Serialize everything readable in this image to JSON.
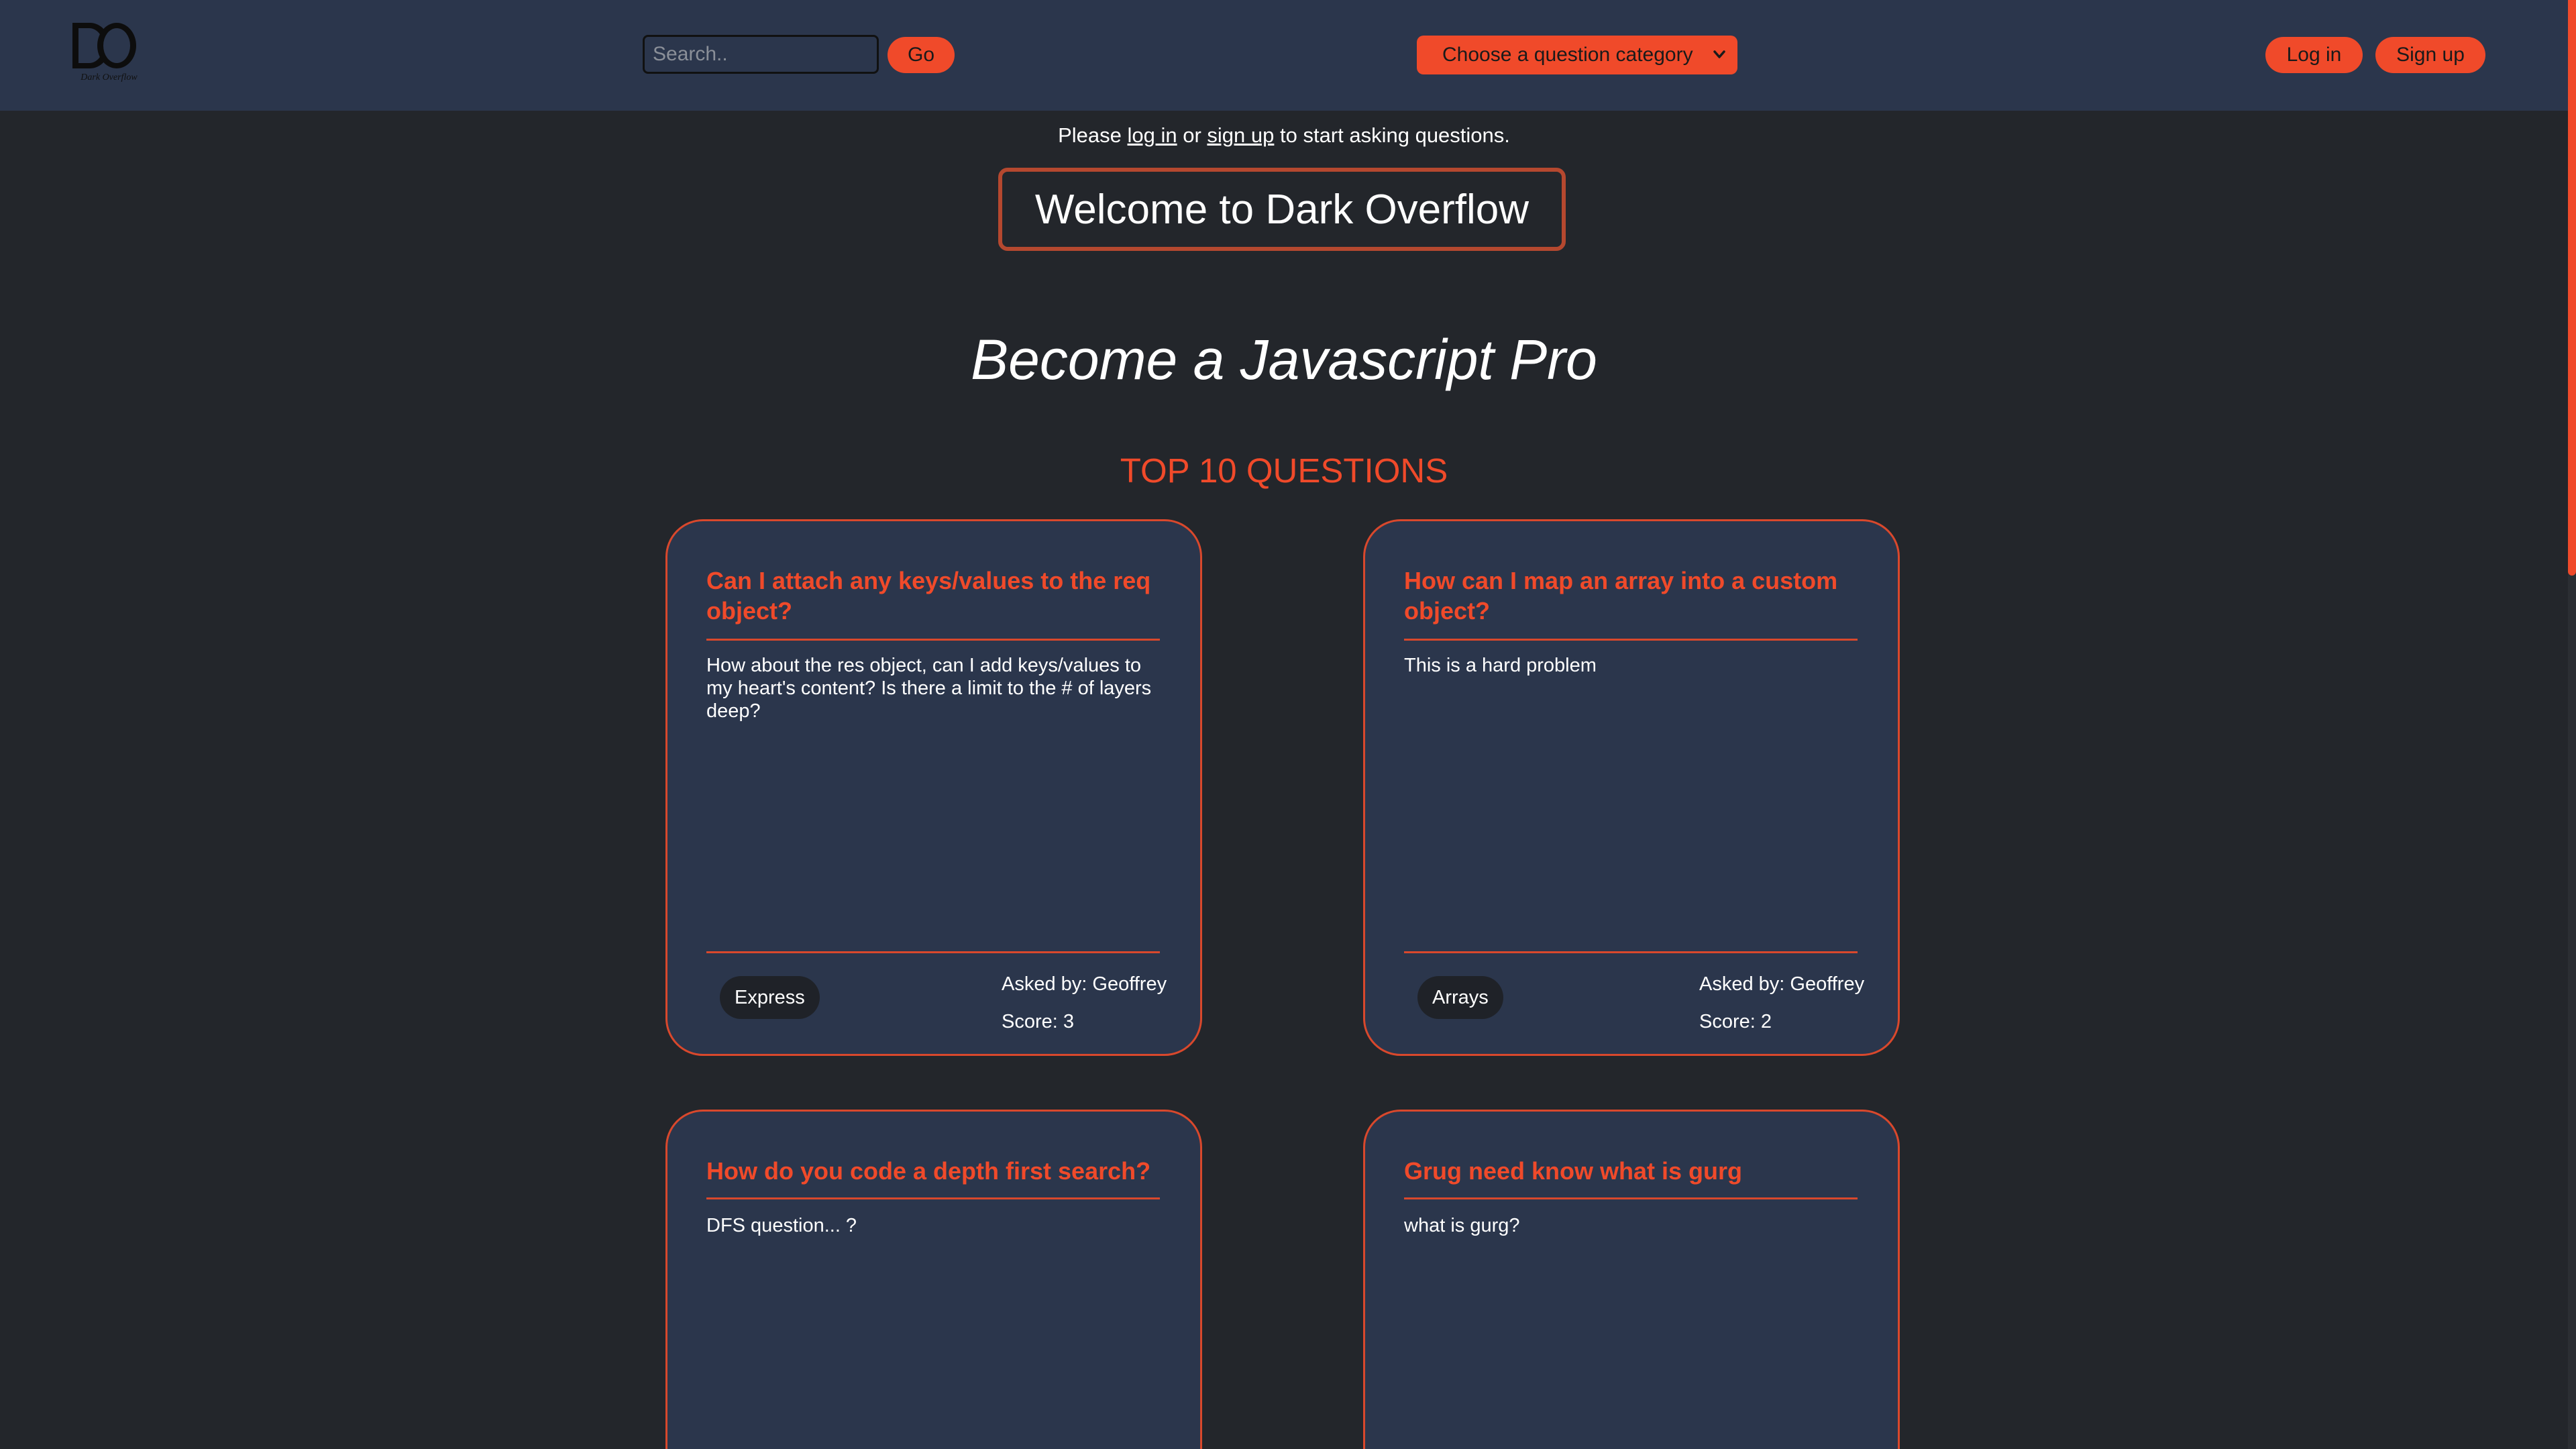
{
  "header": {
    "logo_letters": "DO",
    "logo_caption": "Dark Overflow",
    "search_placeholder": "Search..",
    "go_label": "Go",
    "category_label": "Choose a question category",
    "login_label": "Log in",
    "signup_label": "Sign up"
  },
  "notice": {
    "before": "Please ",
    "login_link": "log in",
    "middle": " or ",
    "signup_link": "sign up",
    "after": " to start asking questions."
  },
  "welcome": "Welcome to Dark Overflow",
  "tagline": "Become a Javascript Pro",
  "top_title": "TOP 10 QUESTIONS",
  "questions": [
    {
      "title": "Can I attach any keys/values to the req object?",
      "body": "How about the res object, can I add keys/values to my heart's content? Is there a limit to the # of layers deep?",
      "tag": "Express",
      "asked_by": "Asked by: Geoffrey",
      "score": "Score: 3"
    },
    {
      "title": "How can I map an array into a custom object?",
      "body": "This is a hard problem",
      "tag": "Arrays",
      "asked_by": "Asked by: Geoffrey",
      "score": "Score: 2"
    },
    {
      "title": "How do you code a depth first search?",
      "body": "DFS question... ?"
    },
    {
      "title": "Grug need know what is gurg",
      "body": "what is gurg?"
    }
  ],
  "colors": {
    "accent": "#f04a2a",
    "header_bg": "#2b364c",
    "page_bg": "#23262b",
    "card_bg": "#2b364c"
  }
}
